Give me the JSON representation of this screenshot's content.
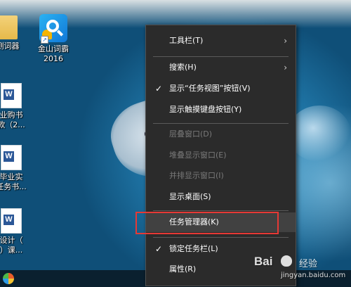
{
  "desktop": {
    "icons": [
      {
        "label_lines": [
          "",
          "测词器"
        ],
        "kind": "folder"
      },
      {
        "label_lines": [
          "金山词霸",
          "2016"
        ],
        "kind": "app-kingsoft"
      },
      {
        "label_lines": [
          "业购书",
          "款（2..."
        ],
        "kind": "word-doc"
      },
      {
        "label_lines": [
          "毕业实",
          "任务书..."
        ],
        "kind": "word-doc"
      },
      {
        "label_lines": [
          "设计（",
          "）课..."
        ],
        "kind": "word-doc"
      }
    ]
  },
  "context_menu": {
    "items": [
      {
        "label": "工具栏(T)",
        "state": "enabled",
        "submenu": true,
        "checked": false
      },
      {
        "label": "搜索(H)",
        "state": "enabled",
        "submenu": true,
        "checked": false
      },
      {
        "label": "显示“任务视图”按钮(V)",
        "state": "enabled",
        "submenu": false,
        "checked": true
      },
      {
        "label": "显示触摸键盘按钮(Y)",
        "state": "enabled",
        "submenu": false,
        "checked": false
      },
      {
        "label": "层叠窗口(D)",
        "state": "disabled",
        "submenu": false,
        "checked": false
      },
      {
        "label": "堆叠显示窗口(E)",
        "state": "disabled",
        "submenu": false,
        "checked": false
      },
      {
        "label": "并排显示窗口(I)",
        "state": "disabled",
        "submenu": false,
        "checked": false
      },
      {
        "label": "显示桌面(S)",
        "state": "enabled",
        "submenu": false,
        "checked": false
      },
      {
        "label": "任务管理器(K)",
        "state": "highlighted",
        "submenu": false,
        "checked": false
      },
      {
        "label": "锁定任务栏(L)",
        "state": "enabled",
        "submenu": false,
        "checked": true
      },
      {
        "label": "属性(R)",
        "state": "enabled",
        "submenu": false,
        "checked": false
      }
    ],
    "submenu_glyph": "›",
    "check_glyph": "✓"
  },
  "watermark": {
    "brand": "Bai",
    "brand_suffix": "经验",
    "url": "jingyan.baidu.com"
  },
  "colors": {
    "menu_bg": "#2b2b2b",
    "menu_text": "#ffffff",
    "menu_disabled": "#7a7a7a",
    "highlight_border": "#e53935"
  }
}
